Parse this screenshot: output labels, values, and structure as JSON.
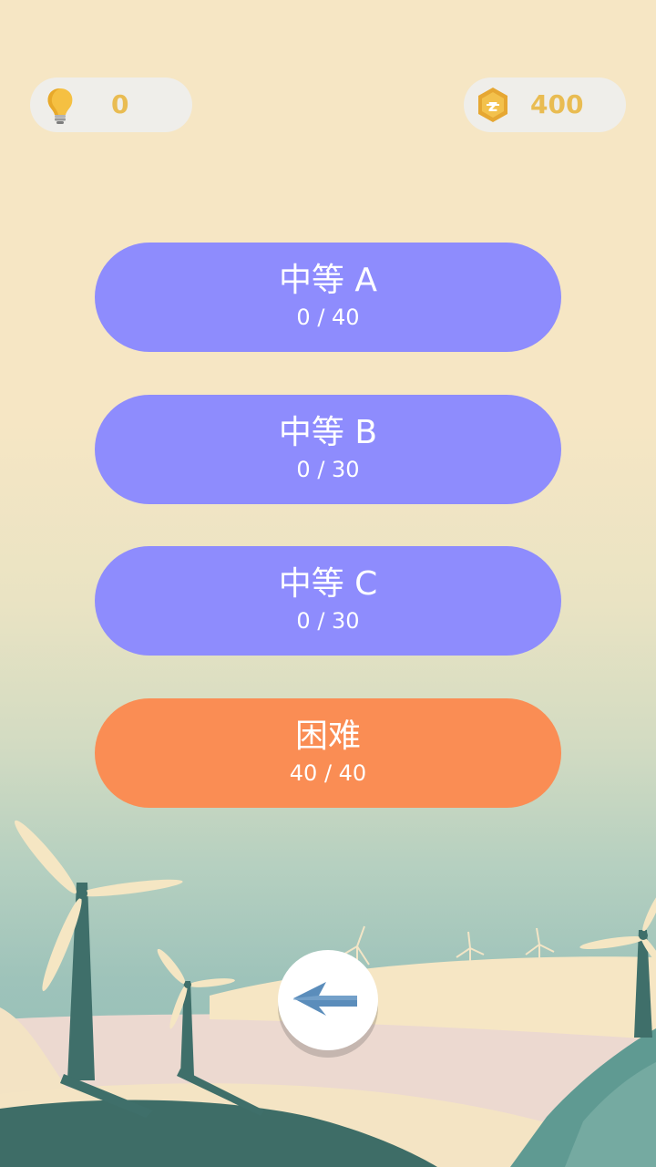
{
  "hud": {
    "hints": {
      "icon": "lightbulb-icon",
      "count": "0"
    },
    "coins": {
      "icon": "coin-icon",
      "count": "400"
    }
  },
  "levels": [
    {
      "name": "中等 A",
      "progress": "0 / 40",
      "color": "#8e8cfd"
    },
    {
      "name": "中等 B",
      "progress": "0 / 30",
      "color": "#8e8cfd"
    },
    {
      "name": "中等 C",
      "progress": "0 / 30",
      "color": "#8e8cfd"
    },
    {
      "name": "困难",
      "progress": "40 / 40",
      "color": "#fa8d54"
    }
  ],
  "back_button": {
    "icon": "arrow-left-icon"
  },
  "colors": {
    "accent_gold": "#e9bc52",
    "medium_button": "#8e8cfd",
    "hard_button": "#fa8d54",
    "turbine_pole": "#3f6f6a",
    "turbine_blade": "#f5e6c3"
  }
}
